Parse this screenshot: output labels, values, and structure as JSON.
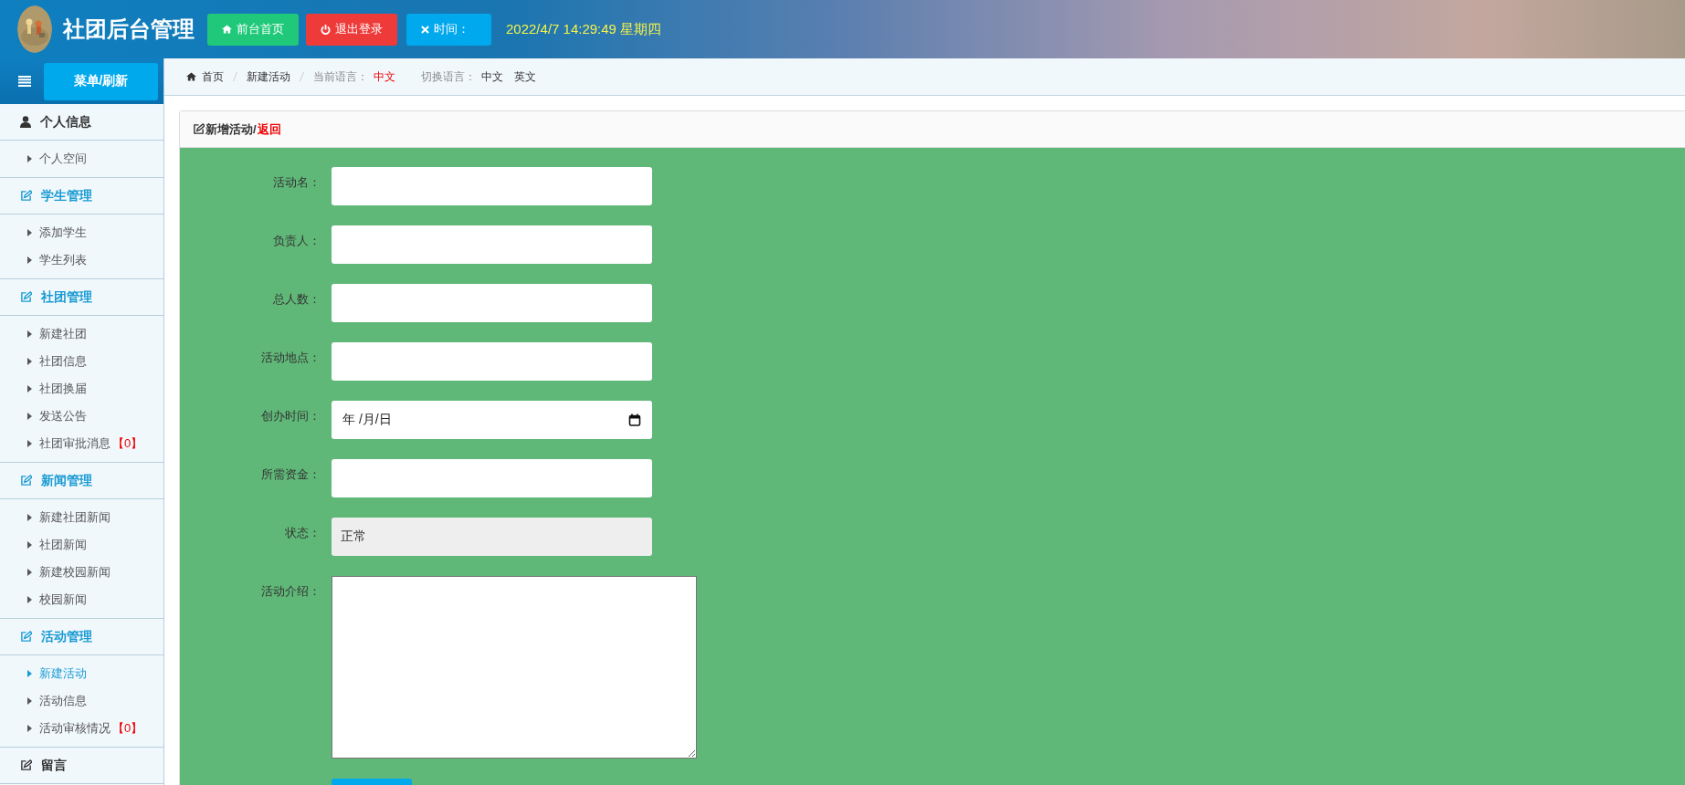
{
  "header": {
    "title": "社团后台管理",
    "buttons": [
      {
        "label": "前台首页",
        "kind": "home"
      },
      {
        "label": "退出登录",
        "kind": "logout"
      },
      {
        "label": "时间：",
        "kind": "time"
      }
    ],
    "datetime": "2022/4/7 14:29:49 星期四"
  },
  "sidebar": {
    "toggle_label": "菜单/刷新",
    "sections": [
      {
        "label": "个人信息",
        "kind": "user",
        "children": [
          {
            "label": "个人空间",
            "selected": false
          }
        ]
      },
      {
        "label": "学生管理",
        "kind": "module",
        "children": [
          {
            "label": "添加学生",
            "selected": false
          },
          {
            "label": "学生列表",
            "selected": false
          }
        ]
      },
      {
        "label": "社团管理",
        "kind": "module",
        "children": [
          {
            "label": "新建社团",
            "selected": false
          },
          {
            "label": "社团信息",
            "selected": false
          },
          {
            "label": "社团换届",
            "selected": false
          },
          {
            "label": "发送公告",
            "selected": false
          },
          {
            "label": "社团审批消息",
            "badge": "【0】",
            "selected": false
          }
        ]
      },
      {
        "label": "新闻管理",
        "kind": "module",
        "children": [
          {
            "label": "新建社团新闻",
            "selected": false
          },
          {
            "label": "社团新闻",
            "selected": false
          },
          {
            "label": "新建校园新闻",
            "selected": false
          },
          {
            "label": "校园新闻",
            "selected": false
          }
        ]
      },
      {
        "label": "活动管理",
        "kind": "module",
        "children": [
          {
            "label": "新建活动",
            "selected": true
          },
          {
            "label": "活动信息",
            "selected": false
          },
          {
            "label": "活动审核情况",
            "badge": "【0】",
            "selected": false
          }
        ]
      },
      {
        "label": "留言",
        "kind": "message"
      }
    ]
  },
  "breadcrumb": {
    "items": [
      "首页",
      "新建活动"
    ],
    "current_language_label": "当前语言：",
    "current_language": "中文",
    "switch_label": "切换语言：",
    "languages": [
      "中文",
      "英文"
    ]
  },
  "panel": {
    "title": "新增活动/",
    "back_link": "返回"
  },
  "form": {
    "fields": [
      {
        "label": "活动名：",
        "kind": "text"
      },
      {
        "label": "负责人：",
        "kind": "text"
      },
      {
        "label": "总人数：",
        "kind": "text"
      },
      {
        "label": "活动地点：",
        "kind": "text"
      },
      {
        "label": "创办时间：",
        "kind": "date",
        "placeholder": "年 /月/日"
      },
      {
        "label": "所需资金：",
        "kind": "text"
      },
      {
        "label": "状态：",
        "kind": "readonly",
        "value": "正常"
      },
      {
        "label": "活动介绍：",
        "kind": "textarea"
      }
    ]
  }
}
